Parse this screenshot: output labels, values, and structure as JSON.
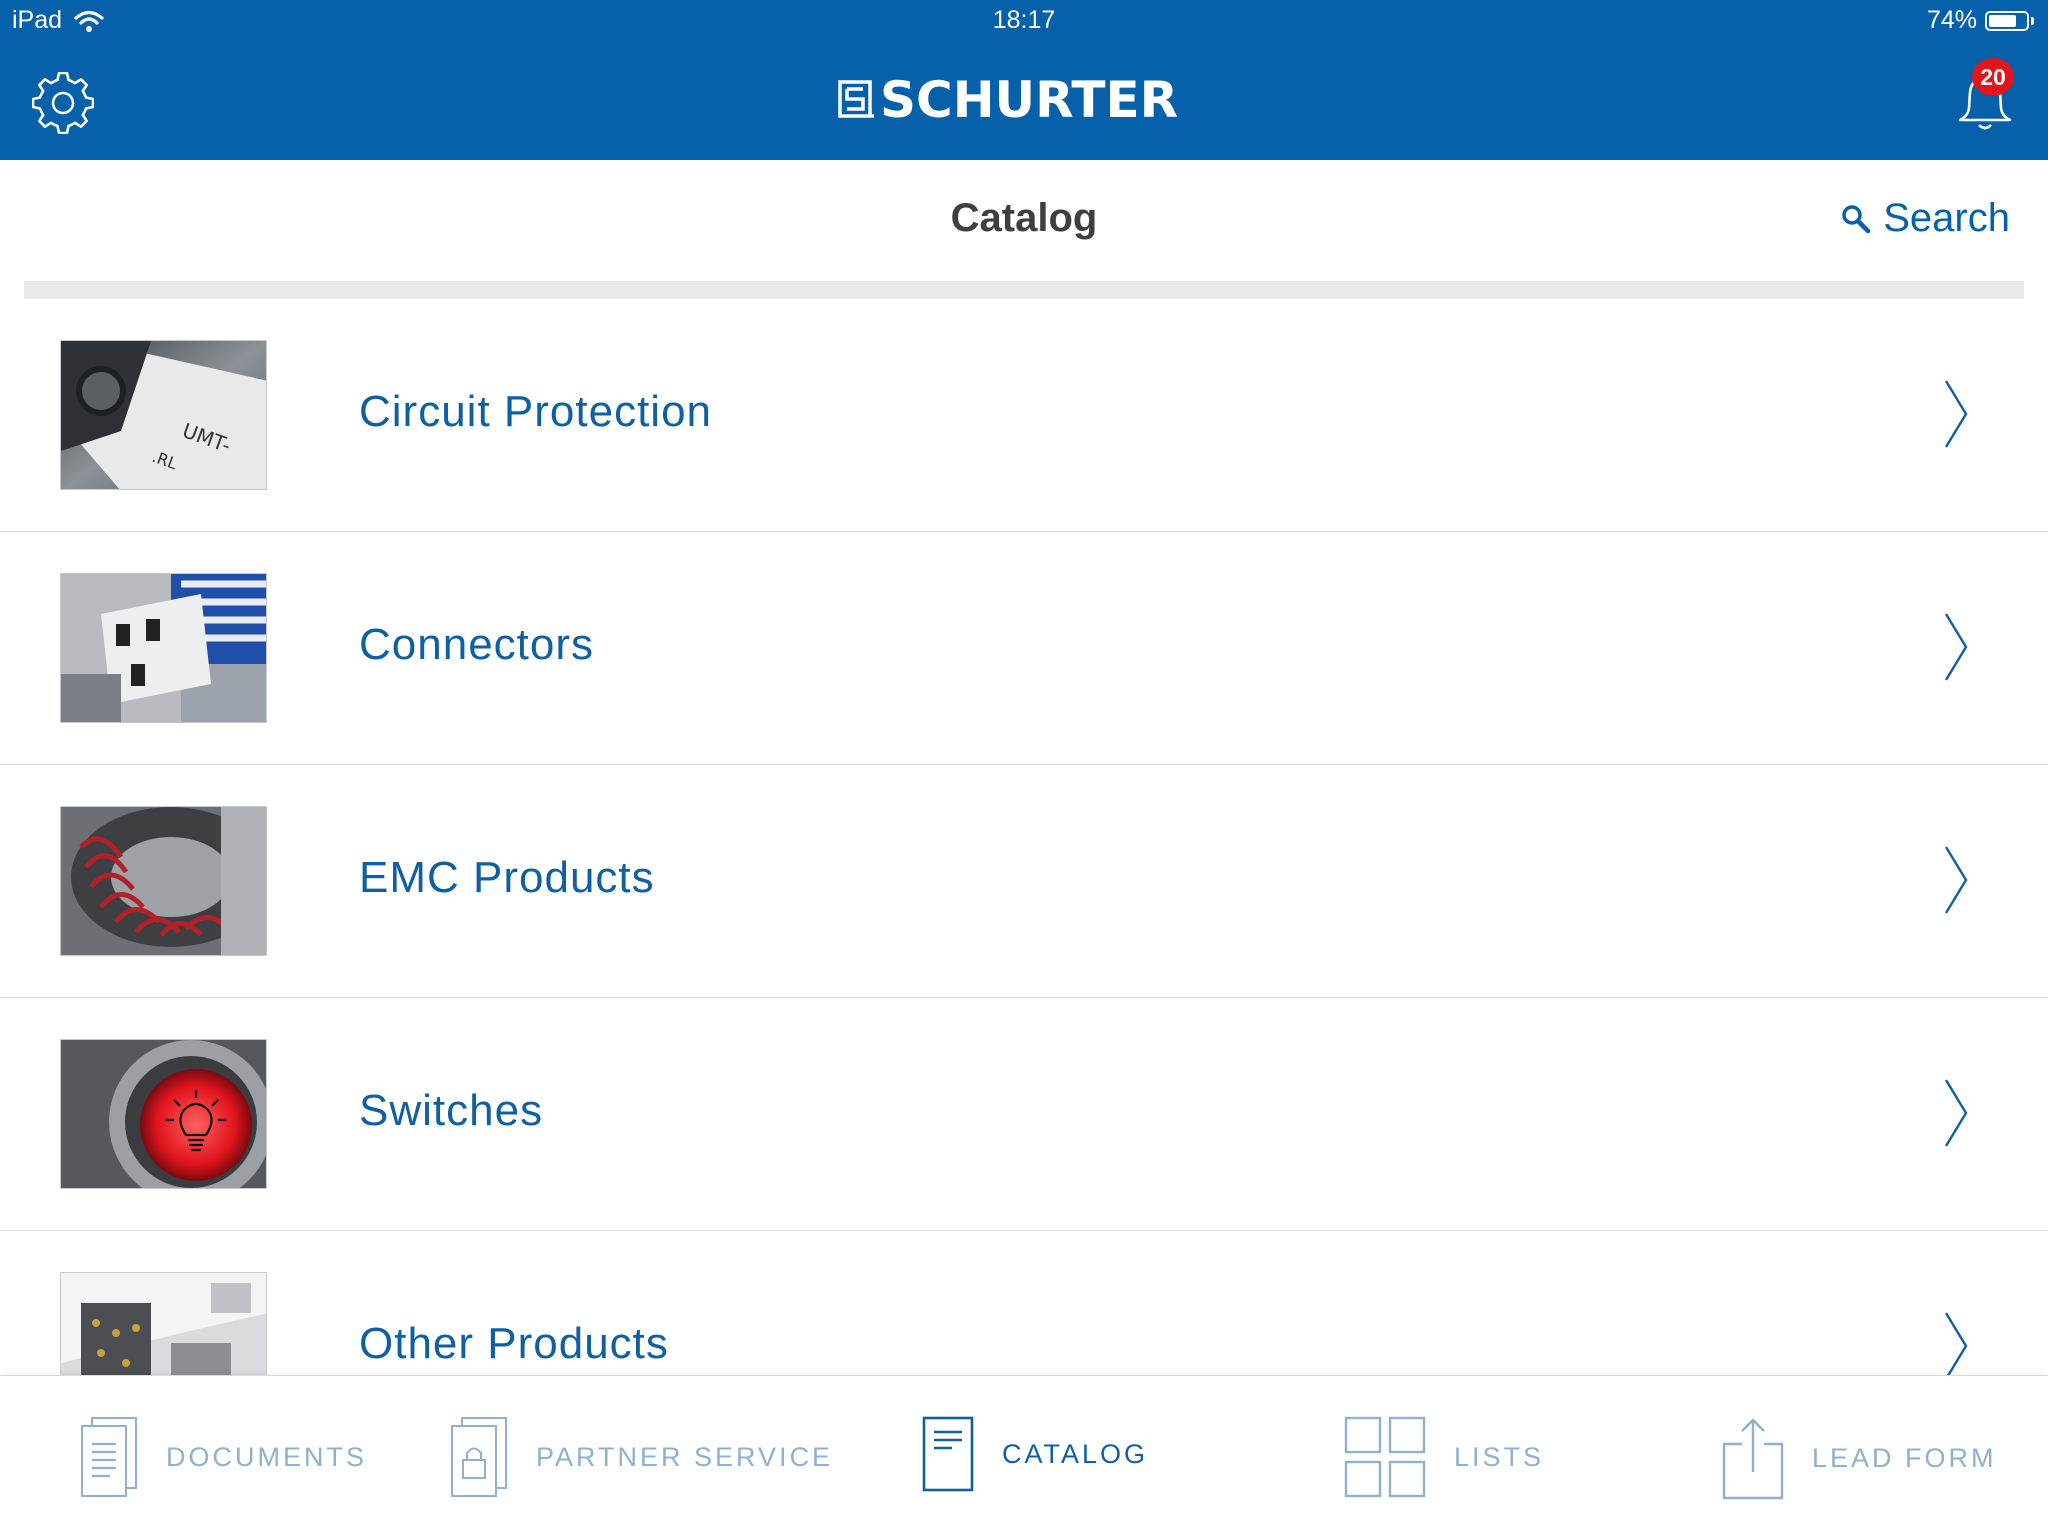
{
  "status_bar": {
    "device": "iPad",
    "time": "18:17",
    "battery": "74%",
    "battery_level": 0.74
  },
  "header": {
    "brand": "SCHURTER",
    "notification_count": "20",
    "icons": {
      "settings": "gear-icon",
      "notifications": "bell-icon"
    },
    "colors": {
      "header_bg": "#0760aa",
      "badge": "#e3141b"
    }
  },
  "title_bar": {
    "title": "Catalog",
    "search_label": "Search"
  },
  "catalog": {
    "items": [
      {
        "label": "Circuit Protection",
        "thumb": "circuit-protection-thumbnail"
      },
      {
        "label": "Connectors",
        "thumb": "connectors-thumbnail"
      },
      {
        "label": "EMC Products",
        "thumb": "emc-products-thumbnail"
      },
      {
        "label": "Switches",
        "thumb": "switches-thumbnail"
      },
      {
        "label": "Other Products",
        "thumb": "other-products-thumbnail"
      }
    ],
    "link_color": "#0f5fa3"
  },
  "tabbar": {
    "tabs": [
      {
        "label": "DOCUMENTS",
        "icon": "documents-icon",
        "active": false
      },
      {
        "label": "PARTNER SERVICE",
        "icon": "partner-lock-icon",
        "active": false
      },
      {
        "label": "CATALOG",
        "icon": "catalog-icon",
        "active": true
      },
      {
        "label": "LISTS",
        "icon": "grid-icon",
        "active": false
      },
      {
        "label": "LEAD FORM",
        "icon": "share-icon",
        "active": false
      }
    ],
    "colors": {
      "active": "#0f5fa3",
      "inactive": "#8fb0cf"
    }
  }
}
